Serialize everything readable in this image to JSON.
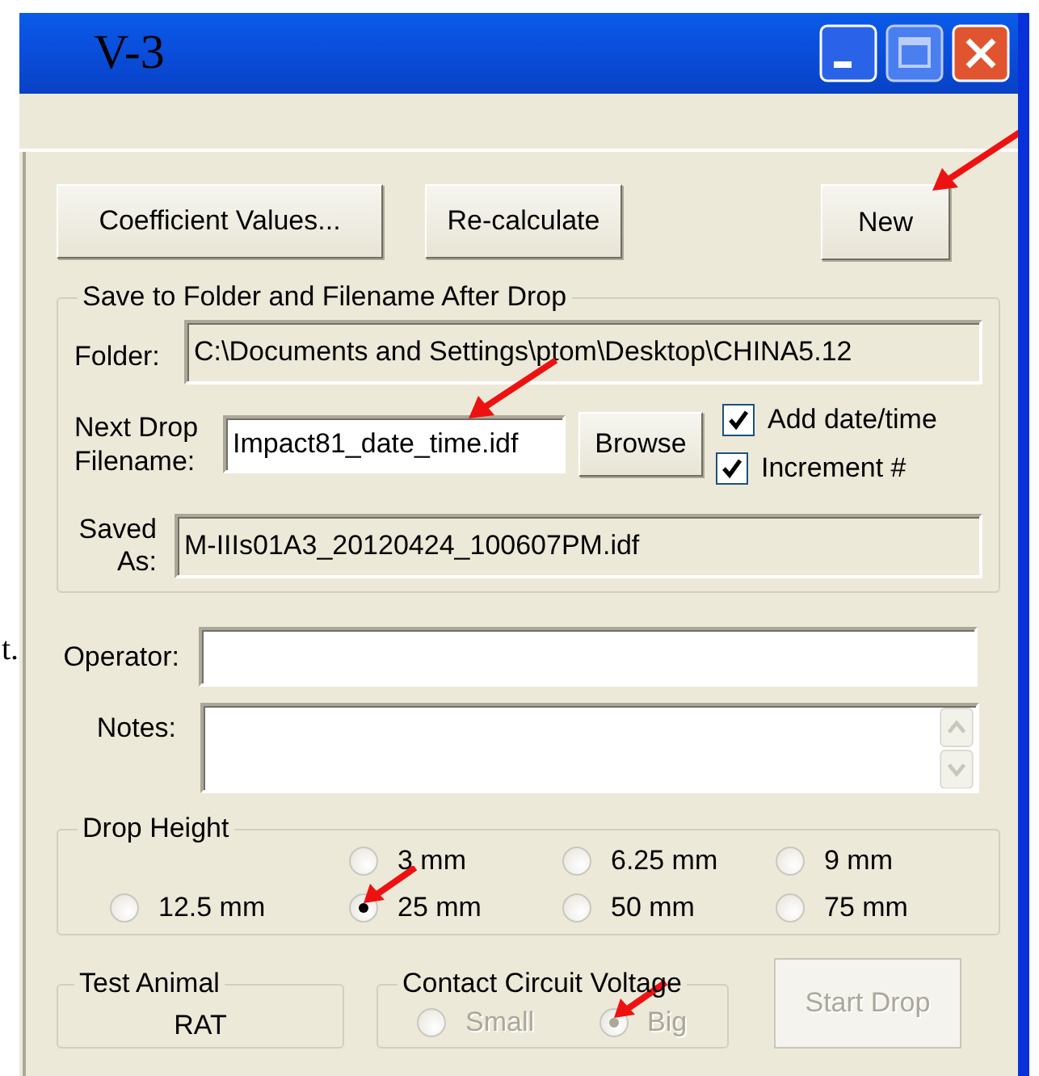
{
  "window": {
    "title": "V-3"
  },
  "background_text": "t.",
  "toolbar": [
    {
      "label": "Coefficient Values...",
      "annotated": false
    },
    {
      "label": "Re-calculate",
      "annotated": false
    },
    {
      "label": "New",
      "annotated": true
    }
  ],
  "save_group": {
    "title": "Save to Folder and Filename After Drop",
    "folder": {
      "label": "Folder:",
      "value": "C:\\Documents and Settings\\ptom\\Desktop\\CHINA5.12"
    },
    "next_filename": {
      "label": "Next Drop Filename:",
      "value": "Impact81_date_time.idf",
      "annotated": true
    },
    "browse": "Browse",
    "options": [
      {
        "label": "Add date/time",
        "checked": true
      },
      {
        "label": "Increment #",
        "checked": true
      }
    ],
    "saved_as": {
      "label": "Saved As:",
      "value": "M-IIIs01A3_20120424_100607PM.idf"
    }
  },
  "operator": {
    "label": "Operator:"
  },
  "notes": {
    "label": "Notes:"
  },
  "drop_height": {
    "title": "Drop Height",
    "options": [
      {
        "label": "3 mm",
        "selected": false,
        "annotated": false
      },
      {
        "label": "6.25 mm",
        "selected": false,
        "annotated": false
      },
      {
        "label": "9 mm",
        "selected": false,
        "annotated": false
      },
      {
        "label": "12.5 mm",
        "selected": false,
        "annotated": false
      },
      {
        "label": "25 mm",
        "selected": true,
        "annotated": true
      },
      {
        "label": "50 mm",
        "selected": false,
        "annotated": false
      },
      {
        "label": "75 mm",
        "selected": false,
        "annotated": false
      }
    ]
  },
  "test_animal": {
    "title": "Test Animal",
    "value": "RAT"
  },
  "voltage": {
    "title": "Contact Circuit Voltage",
    "disabled": true,
    "options": [
      {
        "label": "Small",
        "selected": false,
        "annotated": false
      },
      {
        "label": "Big",
        "selected": true,
        "annotated": true
      }
    ]
  },
  "start_button": {
    "label": "Start Drop",
    "disabled": true
  }
}
